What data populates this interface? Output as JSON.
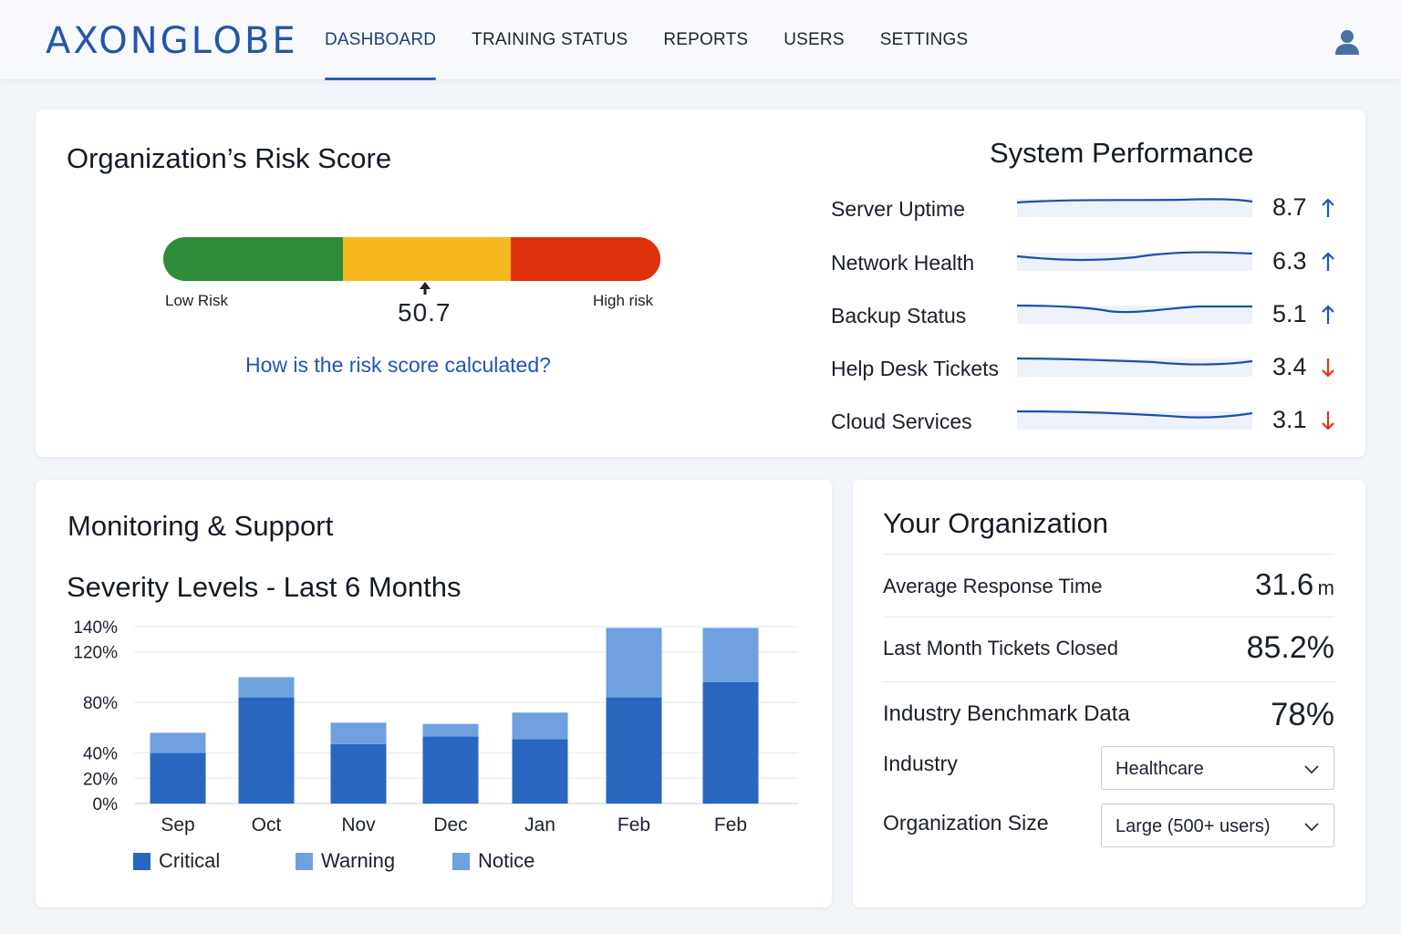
{
  "header": {
    "logo": "AXONGLOBE",
    "nav": [
      {
        "label": "DASHBOARD",
        "active": true
      },
      {
        "label": "TRAINING STATUS",
        "active": false
      },
      {
        "label": "REPORTS",
        "active": false
      },
      {
        "label": "USERS",
        "active": false
      },
      {
        "label": "SETTINGS",
        "active": false
      }
    ],
    "user_icon": "user-icon"
  },
  "risk": {
    "title": "Organization’s Risk Score",
    "low_label": "Low Risk",
    "high_label": "High risk",
    "value": "50.7",
    "link": "How is the risk score calculated?",
    "colors": {
      "low": "#2e8b3a",
      "mid": "#f8b820",
      "high": "#e0310e"
    }
  },
  "performance": {
    "title": "System Performance",
    "items": [
      {
        "label": "Server Uptime",
        "value": "8.7",
        "trend": "up"
      },
      {
        "label": "Network Health",
        "value": "6.3",
        "trend": "up"
      },
      {
        "label": "Backup Status",
        "value": "5.1",
        "trend": "up"
      },
      {
        "label": "Help Desk Tickets",
        "value": "3.4",
        "trend": "down"
      },
      {
        "label": "Cloud Services",
        "value": "3.1",
        "trend": "down"
      }
    ],
    "colors": {
      "up": "#1f55b5",
      "down": "#d8361c",
      "spark": "#1f4fa8"
    }
  },
  "monitoring": {
    "title": "Monitoring & Support",
    "legend": [
      {
        "label": "Critical",
        "color": "#2866bf"
      },
      {
        "label": "Warning",
        "color": "#6fa0e0"
      },
      {
        "label": "Notice",
        "color": "#6fa0e0"
      }
    ]
  },
  "chart_data": {
    "type": "bar",
    "title": "Severity Levels - Last 6 Months",
    "categories": [
      "Sep",
      "Oct",
      "Nov",
      "Dec",
      "Jan",
      "Feb",
      "Feb"
    ],
    "series": [
      {
        "name": "Critical",
        "values": [
          40,
          84,
          47,
          53,
          51,
          84,
          96
        ]
      },
      {
        "name": "Warning",
        "values": [
          16,
          16,
          17,
          10,
          21,
          55,
          43
        ]
      }
    ],
    "y_ticks": [
      "0%",
      "20%",
      "40%",
      "80%",
      "120%",
      "140%"
    ],
    "ylim": [
      0,
      140
    ],
    "grid": true,
    "legend_position": "bottom",
    "stacked": true
  },
  "organization": {
    "title": "Your Organization",
    "avg_response_label": "Average Response Time",
    "avg_response_value": "31.6",
    "avg_response_unit": "m",
    "tickets_label": "Last Month Tickets Closed",
    "tickets_value": "85.2%",
    "benchmark_label": "Industry Benchmark Data",
    "benchmark_value": "78%",
    "industry_label": "Industry",
    "industry_selected": "Healthcare",
    "size_label": "Organization Size",
    "size_selected": "Large (500+ users)"
  }
}
